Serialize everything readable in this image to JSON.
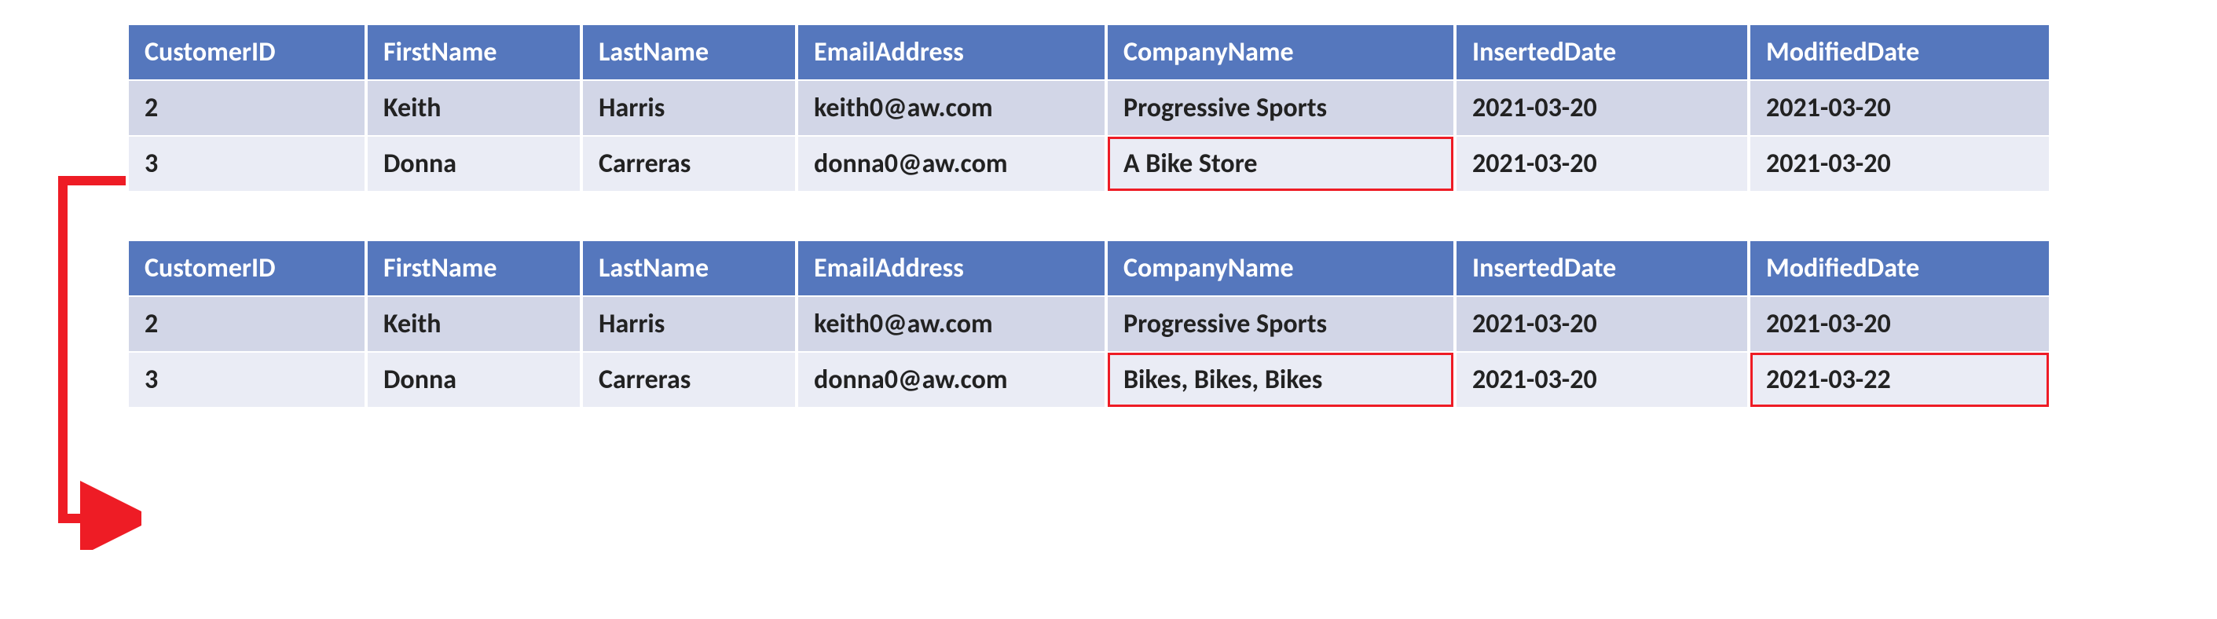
{
  "columns": [
    "CustomerID",
    "FirstName",
    "LastName",
    "EmailAddress",
    "CompanyName",
    "InsertedDate",
    "ModifiedDate"
  ],
  "table_before": {
    "rows": [
      {
        "CustomerID": "2",
        "FirstName": "Keith",
        "LastName": "Harris",
        "EmailAddress": "keith0@aw.com",
        "CompanyName": "Progressive Sports",
        "InsertedDate": "2021-03-20",
        "ModifiedDate": "2021-03-20"
      },
      {
        "CustomerID": "3",
        "FirstName": "Donna",
        "LastName": "Carreras",
        "EmailAddress": "donna0@aw.com",
        "CompanyName": "A Bike Store",
        "InsertedDate": "2021-03-20",
        "ModifiedDate": "2021-03-20"
      }
    ],
    "highlights": [
      {
        "row": 1,
        "col": "CompanyName"
      }
    ]
  },
  "table_after": {
    "rows": [
      {
        "CustomerID": "2",
        "FirstName": "Keith",
        "LastName": "Harris",
        "EmailAddress": "keith0@aw.com",
        "CompanyName": "Progressive Sports",
        "InsertedDate": "2021-03-20",
        "ModifiedDate": "2021-03-20"
      },
      {
        "CustomerID": "3",
        "FirstName": "Donna",
        "LastName": "Carreras",
        "EmailAddress": "donna0@aw.com",
        "CompanyName": "Bikes, Bikes, Bikes",
        "InsertedDate": "2021-03-20",
        "ModifiedDate": "2021-03-22"
      }
    ],
    "highlights": [
      {
        "row": 1,
        "col": "CompanyName"
      },
      {
        "row": 1,
        "col": "ModifiedDate"
      }
    ]
  },
  "colors": {
    "header_bg": "#5577bd",
    "header_fg": "#ffffff",
    "row_odd_bg": "#d2d6e7",
    "row_even_bg": "#eaecf5",
    "highlight_border": "#ee1c25",
    "connector": "#ee1c25"
  }
}
